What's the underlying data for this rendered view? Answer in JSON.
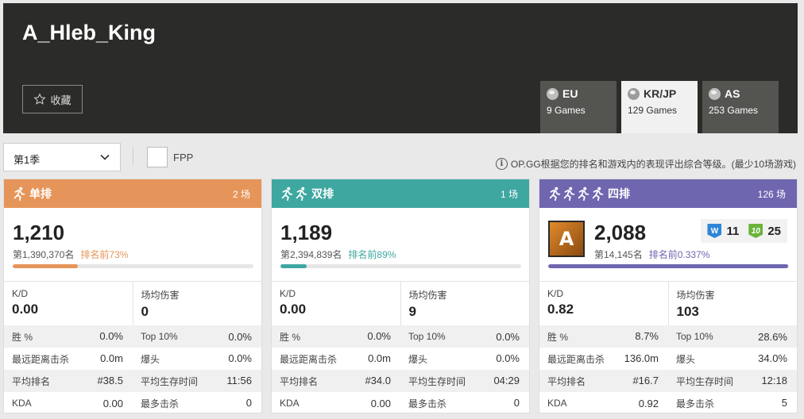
{
  "player": {
    "name": "A_Hleb_King",
    "favorite_label": "收藏"
  },
  "regions": [
    {
      "name": "EU",
      "games": "9 Games",
      "active": false
    },
    {
      "name": "KR/JP",
      "games": "129 Games",
      "active": true
    },
    {
      "name": "AS",
      "games": "253 Games",
      "active": false
    }
  ],
  "filters": {
    "season": "第1季",
    "fpp_label": "FPP",
    "fpp_checked": false
  },
  "notice": "OP.GG根据您的排名和游戏内的表现评出综合等级。(最少10场游戏)",
  "cards": [
    {
      "mode": "单排",
      "count": "2 场",
      "color": "#e6955a",
      "rating": "1,210",
      "rank": "第1,390,370名",
      "rank_pct": "排名前73%",
      "pct_color": "#e6955a",
      "progress": 0.27,
      "kd_label": "K/D",
      "kd": "0.00",
      "dmg_label": "场均伤害",
      "dmg": "0",
      "stats": [
        [
          "胜 %",
          "0.0%",
          "Top 10%",
          "0.0%"
        ],
        [
          "最远距离击杀",
          "0.0m",
          "爆头",
          "0.0%"
        ],
        [
          "平均排名",
          "#38.5",
          "平均生存时间",
          "11:56"
        ],
        [
          "KDA",
          "0.00",
          "最多击杀",
          "0"
        ]
      ]
    },
    {
      "mode": "双排",
      "count": "1 场",
      "color": "#3ea7a0",
      "rating": "1,189",
      "rank": "第2,394,839名",
      "rank_pct": "排名前89%",
      "pct_color": "#3ea7a0",
      "progress": 0.11,
      "kd_label": "K/D",
      "kd": "0.00",
      "dmg_label": "场均伤害",
      "dmg": "9",
      "stats": [
        [
          "胜 %",
          "0.0%",
          "Top 10%",
          "0.0%"
        ],
        [
          "最远距离击杀",
          "0.0m",
          "爆头",
          "0.0%"
        ],
        [
          "平均排名",
          "#34.0",
          "平均生存时间",
          "04:29"
        ],
        [
          "KDA",
          "0.00",
          "最多击杀",
          "0"
        ]
      ]
    },
    {
      "mode": "四排",
      "count": "126 场",
      "color": "#6f66b0",
      "rating": "2,088",
      "rank": "第14,145名",
      "rank_pct": "排名前0.337%",
      "pct_color": "#6f66b0",
      "progress": 0.997,
      "tier_letter": "A",
      "wins": "11",
      "top10": "25",
      "kd_label": "K/D",
      "kd": "0.82",
      "dmg_label": "场均伤害",
      "dmg": "103",
      "stats": [
        [
          "胜 %",
          "8.7%",
          "Top 10%",
          "28.6%"
        ],
        [
          "最远距离击杀",
          "136.0m",
          "爆头",
          "34.0%"
        ],
        [
          "平均排名",
          "#16.7",
          "平均生存时间",
          "12:18"
        ],
        [
          "KDA",
          "0.92",
          "最多击杀",
          "5"
        ]
      ]
    }
  ],
  "icons": {
    "star": "star-outline-icon",
    "chevron": "chevron-down-icon",
    "info": "info-icon",
    "runner": "runner-icon",
    "globe": "globe-icon"
  }
}
